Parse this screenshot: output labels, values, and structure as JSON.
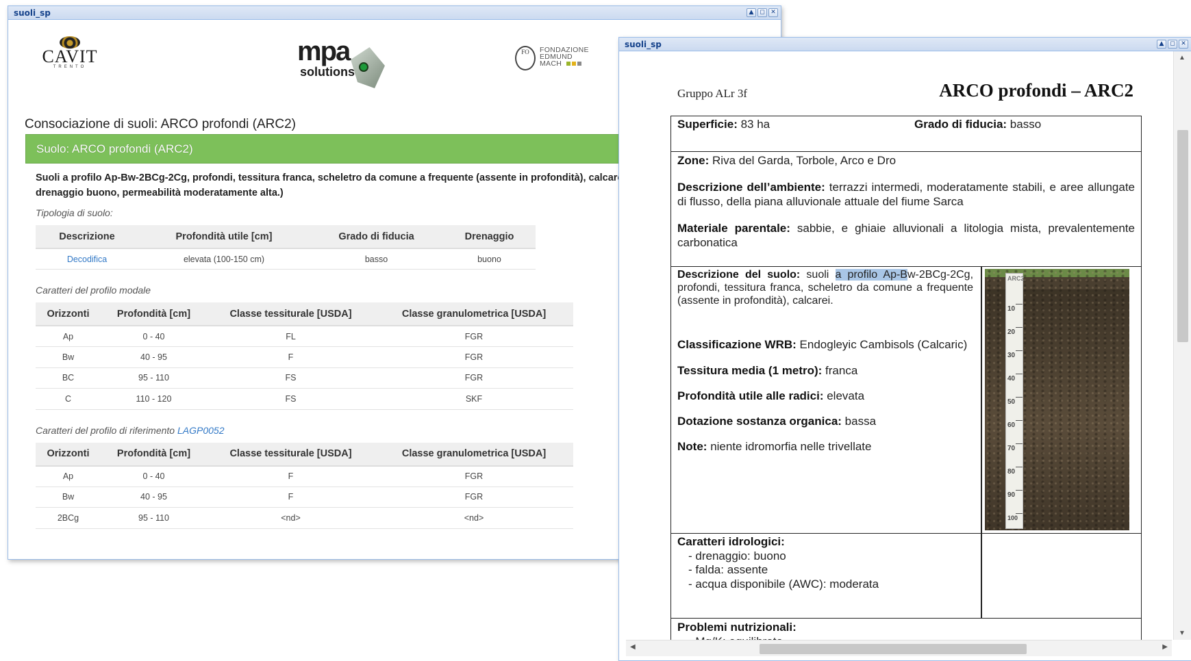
{
  "window1": {
    "title": "suoli_sp",
    "tools": [
      "▲",
      "◻",
      "✕"
    ],
    "logos": {
      "cavit": "CAVIT",
      "cavit_sub": "TRENTO",
      "mpa": "mpa",
      "mpa_sub": "solutions",
      "fem_line1": "FONDAZIONE",
      "fem_line2": "EDMUND",
      "fem_line3": "MACH",
      "fem_emblem": "FO"
    },
    "heading": "Consociazione di suoli: ARCO profondi (ARC2)",
    "panel_title": "Suolo: ARCO profondi (ARC2)",
    "description_line1": "Suoli a profilo Ap-Bw-2BCg-2Cg, profondi, tessitura franca, scheletro da comune a frequente (assente in profondità), calcarei, ben",
    "description_line2": "drenaggio buono, permeabilità moderatamente alta.)",
    "tipologia_label": "Tipologia di suolo:",
    "tipologia_table": {
      "headers": [
        "Descrizione",
        "Profondità utile [cm]",
        "Grado di fiducia",
        "Drenaggio"
      ],
      "rows": [
        [
          "Decodifica",
          "elevata (100-150 cm)",
          "basso",
          "buono"
        ]
      ]
    },
    "modale_label": "Caratteri del profilo modale",
    "modale_table": {
      "headers": [
        "Orizzonti",
        "Profondità [cm]",
        "Classe tessiturale [USDA]",
        "Classe granulometrica [USDA]"
      ],
      "rows": [
        [
          "Ap",
          "0 - 40",
          "FL",
          "FGR"
        ],
        [
          "Bw",
          "40 - 95",
          "F",
          "FGR"
        ],
        [
          "BC",
          "95 - 110",
          "FS",
          "FGR"
        ],
        [
          "C",
          "110 - 120",
          "FS",
          "SKF"
        ]
      ]
    },
    "riferimento_label": "Caratteri del profilo di riferimento",
    "riferimento_link": "LAGP0052",
    "riferimento_table": {
      "headers": [
        "Orizzonti",
        "Profondità [cm]",
        "Classe tessiturale [USDA]",
        "Classe granulometrica [USDA]"
      ],
      "rows": [
        [
          "Ap",
          "0 - 40",
          "F",
          "FGR"
        ],
        [
          "Bw",
          "40 - 95",
          "F",
          "FGR"
        ],
        [
          "2BCg",
          "95 - 110",
          "<nd>",
          "<nd>"
        ]
      ]
    }
  },
  "window2": {
    "title": "suoli_sp",
    "tools": [
      "▲",
      "◻",
      "✕"
    ],
    "gruppo": "Gruppo ALr 3f",
    "doc_title": "ARCO profondi – ARC2",
    "superficie_label": "Superficie:",
    "superficie_value": "83 ha",
    "fiducia_label": "Grado di fiducia:",
    "fiducia_value": "basso",
    "zone_label": "Zone:",
    "zone_value": "Riva del Garda, Torbole, Arco e Dro",
    "ambiente_label": "Descrizione dell’ambiente:",
    "ambiente_value": "terrazzi intermedi, moderatamente stabili, e aree allungate di flusso, della piana alluvionale attuale del fiume Sarca",
    "materiale_label": "Materiale parentale:",
    "materiale_value": "sabbie, e ghiaie alluvionali a litologia mista, prevalentemente carbonatica",
    "suolo_label": "Descrizione del suolo:",
    "suolo_pre": "suoli",
    "suolo_selected": "a profilo Ap-B",
    "suolo_post": "w-2BCg-2Cg, profondi, tessitura franca, scheletro da comune a frequente (assente in profondità), calcarei.",
    "wrb_label": "Classificazione WRB:",
    "wrb_value": "Endogleyic Cambisols (Calcaric)",
    "tessitura_label": "Tessitura media (1 metro):",
    "tessitura_value": "franca",
    "profondita_label": "Profondità utile alle radici:",
    "profondita_value": "elevata",
    "organica_label": "Dotazione sostanza organica:",
    "organica_value": "bassa",
    "note_label": "Note:",
    "note_value": "niente idromorfia nelle trivellate",
    "ruler_ticks": [
      "10",
      "20",
      "30",
      "40",
      "50",
      "60",
      "70",
      "80",
      "90",
      "100"
    ],
    "ruler_tag": "ARC2",
    "idro_label": "Caratteri idrologici:",
    "idro_items": [
      "- drenaggio: buono",
      "- falda: assente",
      "- acqua disponibile (AWC): moderata"
    ],
    "nutri_label": "Problemi nutrizionali:",
    "nutri_items": [
      "- Mg/K: equilibrato"
    ],
    "scroll_up": "▲",
    "scroll_down": "▼",
    "scroll_left": "◀",
    "scroll_right": "▶"
  }
}
